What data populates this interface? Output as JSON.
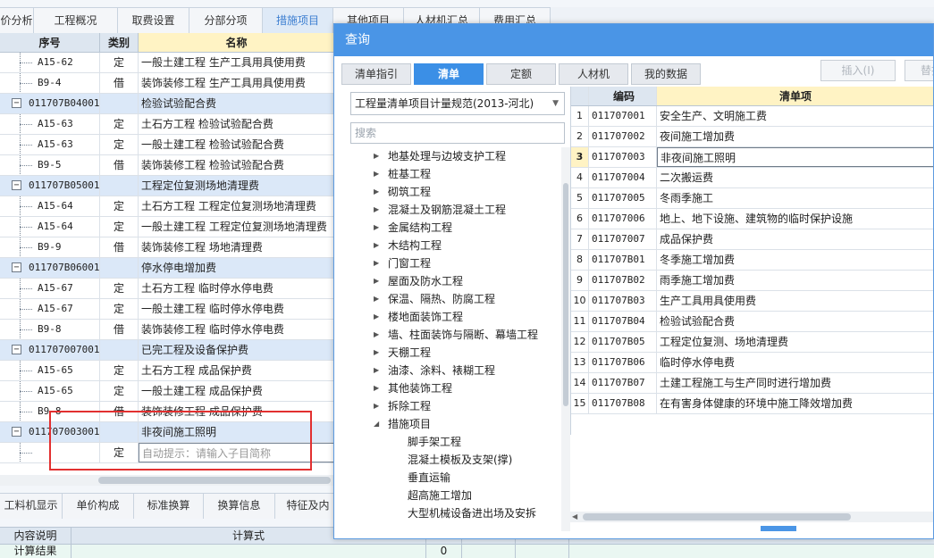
{
  "top_tabs": [
    "价分析",
    "工程概况",
    "取费设置",
    "分部分项",
    "措施项目",
    "其他项目",
    "人材机汇总",
    "费用汇总"
  ],
  "top_tab_active": "措施项目",
  "main_table": {
    "headers": {
      "seq": "序号",
      "type": "类别",
      "name": "名称"
    },
    "rows": [
      {
        "seq": "A15-62",
        "type": "定",
        "name": "一般土建工程 生产工具用具使用费",
        "group": false
      },
      {
        "seq": "B9-4",
        "type": "借",
        "name": "装饰装修工程 生产工具用具使用费",
        "group": false
      },
      {
        "seq": "011707B04001",
        "type": "",
        "name": "检验试验配合费",
        "group": true
      },
      {
        "seq": "A15-63",
        "type": "定",
        "name": "土石方工程 检验试验配合费",
        "group": false
      },
      {
        "seq": "A15-63",
        "type": "定",
        "name": "一般土建工程 检验试验配合费",
        "group": false
      },
      {
        "seq": "B9-5",
        "type": "借",
        "name": "装饰装修工程 检验试验配合费",
        "group": false
      },
      {
        "seq": "011707B05001",
        "type": "",
        "name": "工程定位复测场地清理费",
        "group": true
      },
      {
        "seq": "A15-64",
        "type": "定",
        "name": "土石方工程 工程定位复测场地清理费",
        "group": false
      },
      {
        "seq": "A15-64",
        "type": "定",
        "name": "一般土建工程 工程定位复测场地清理费",
        "group": false
      },
      {
        "seq": "B9-9",
        "type": "借",
        "name": "装饰装修工程 场地清理费",
        "group": false
      },
      {
        "seq": "011707B06001",
        "type": "",
        "name": "停水停电增加费",
        "group": true
      },
      {
        "seq": "A15-67",
        "type": "定",
        "name": "土石方工程 临时停水停电费",
        "group": false
      },
      {
        "seq": "A15-67",
        "type": "定",
        "name": "一般土建工程 临时停水停电费",
        "group": false
      },
      {
        "seq": "B9-8",
        "type": "借",
        "name": "装饰装修工程 临时停水停电费",
        "group": false
      },
      {
        "seq": "011707007001",
        "type": "",
        "name": "已完工程及设备保护费",
        "group": true
      },
      {
        "seq": "A15-65",
        "type": "定",
        "name": "土石方工程 成品保护费",
        "group": false
      },
      {
        "seq": "A15-65",
        "type": "定",
        "name": "一般土建工程 成品保护费",
        "group": false
      },
      {
        "seq": "B9-8",
        "type": "借",
        "name": "装饰装修工程 成品保护费",
        "group": false
      },
      {
        "seq": "011707003001",
        "type": "",
        "name": "非夜间施工照明",
        "group": true
      },
      {
        "seq": "",
        "type": "定",
        "name": "自动提示：请输入子目简称",
        "group": false,
        "hint": true
      }
    ]
  },
  "bottom_tabs": [
    "工料机显示",
    "单价构成",
    "标准换算",
    "换算信息",
    "特征及内"
  ],
  "bottom_table": {
    "headers": [
      "内容说明",
      "计算式"
    ],
    "row_label": "计算结果",
    "row_value": "0"
  },
  "dialog": {
    "title": "查询",
    "tabs": [
      "清单指引",
      "清单",
      "定额",
      "人材机",
      "我的数据"
    ],
    "active_tab": "清单",
    "insert_button": "插入(I)",
    "replace_button": "替换",
    "spec_select": "工程量清单项目计量规范(2013-河北)",
    "search_placeholder": "搜索",
    "tree": [
      {
        "label": "地基处理与边坡支护工程",
        "expanded": false,
        "child": false
      },
      {
        "label": "桩基工程",
        "expanded": false,
        "child": false
      },
      {
        "label": "砌筑工程",
        "expanded": false,
        "child": false
      },
      {
        "label": "混凝土及钢筋混凝土工程",
        "expanded": false,
        "child": false
      },
      {
        "label": "金属结构工程",
        "expanded": false,
        "child": false
      },
      {
        "label": "木结构工程",
        "expanded": false,
        "child": false
      },
      {
        "label": "门窗工程",
        "expanded": false,
        "child": false
      },
      {
        "label": "屋面及防水工程",
        "expanded": false,
        "child": false
      },
      {
        "label": "保温、隔热、防腐工程",
        "expanded": false,
        "child": false
      },
      {
        "label": "楼地面装饰工程",
        "expanded": false,
        "child": false
      },
      {
        "label": "墙、柱面装饰与隔断、幕墙工程",
        "expanded": false,
        "child": false
      },
      {
        "label": "天棚工程",
        "expanded": false,
        "child": false
      },
      {
        "label": "油漆、涂料、裱糊工程",
        "expanded": false,
        "child": false
      },
      {
        "label": "其他装饰工程",
        "expanded": false,
        "child": false
      },
      {
        "label": "拆除工程",
        "expanded": false,
        "child": false
      },
      {
        "label": "措施项目",
        "expanded": true,
        "child": false
      },
      {
        "label": "脚手架工程",
        "expanded": false,
        "child": true
      },
      {
        "label": "混凝土模板及支架(撑)",
        "expanded": false,
        "child": true
      },
      {
        "label": "垂直运输",
        "expanded": false,
        "child": true
      },
      {
        "label": "超高施工增加",
        "expanded": false,
        "child": true
      },
      {
        "label": "大型机械设备进出场及安拆",
        "expanded": false,
        "child": true
      }
    ],
    "grid_headers": {
      "code": "编码",
      "name": "清单项"
    },
    "grid_rows": [
      {
        "idx": "1",
        "code": "011707001",
        "name": "安全生产、文明施工费"
      },
      {
        "idx": "2",
        "code": "011707002",
        "name": "夜间施工增加费"
      },
      {
        "idx": "3",
        "code": "011707003",
        "name": "非夜间施工照明"
      },
      {
        "idx": "4",
        "code": "011707004",
        "name": "二次搬运费"
      },
      {
        "idx": "5",
        "code": "011707005",
        "name": "冬雨季施工"
      },
      {
        "idx": "6",
        "code": "011707006",
        "name": "地上、地下设施、建筑物的临时保护设施"
      },
      {
        "idx": "7",
        "code": "011707007",
        "name": "成品保护费"
      },
      {
        "idx": "8",
        "code": "011707B01",
        "name": "冬季施工增加费"
      },
      {
        "idx": "9",
        "code": "011707B02",
        "name": "雨季施工增加费"
      },
      {
        "idx": "10",
        "code": "011707B03",
        "name": "生产工具用具使用费"
      },
      {
        "idx": "11",
        "code": "011707B04",
        "name": "检验试验配合费"
      },
      {
        "idx": "12",
        "code": "011707B05",
        "name": "工程定位复测、场地清理费"
      },
      {
        "idx": "13",
        "code": "011707B06",
        "name": "临时停水停电费"
      },
      {
        "idx": "14",
        "code": "011707B07",
        "name": "土建工程施工与生产同时进行增加费"
      },
      {
        "idx": "15",
        "code": "011707B08",
        "name": "在有害身体健康的环境中施工降效增加费"
      }
    ],
    "selected_row": "3"
  }
}
